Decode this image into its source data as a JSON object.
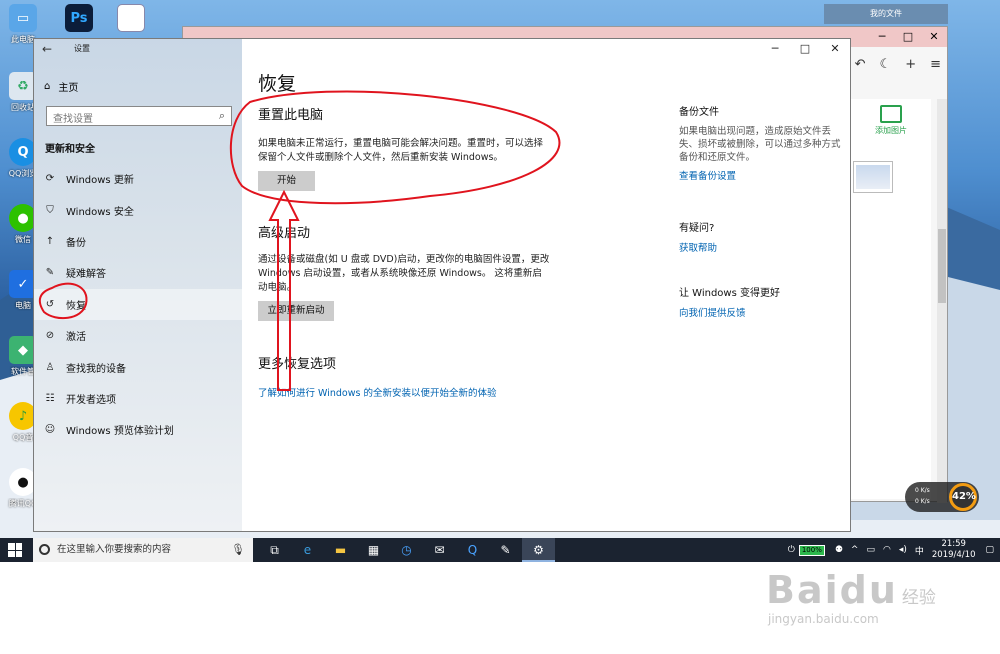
{
  "desktop": {
    "icons": [
      {
        "label": "此电脑",
        "icon": "computer-icon"
      },
      {
        "label": "回收站",
        "icon": "recycle-bin-icon"
      },
      {
        "label": "QQ浏览",
        "icon": "qq-browser-icon"
      },
      {
        "label": "微信",
        "icon": "wechat-icon"
      },
      {
        "label": "电脑",
        "icon": "pc-manager-icon"
      },
      {
        "label": "软件管",
        "icon": "software-manager-icon"
      },
      {
        "label": "QQ音",
        "icon": "qq-music-icon"
      },
      {
        "label": "腾讯QQ",
        "icon": "qq-icon"
      }
    ],
    "ps_label": "Ps",
    "bg_window_title": "我的文件",
    "bg_window_add_picture": "添加图片"
  },
  "settings": {
    "app_title": "设置",
    "home": "主页",
    "search_placeholder": "查找设置",
    "section": "更新和安全",
    "nav": [
      {
        "label": "Windows 更新",
        "icon": "refresh-icon"
      },
      {
        "label": "Windows 安全",
        "icon": "shield-icon"
      },
      {
        "label": "备份",
        "icon": "backup-arrow-icon"
      },
      {
        "label": "疑难解答",
        "icon": "wrench-icon"
      },
      {
        "label": "恢复",
        "icon": "history-icon"
      },
      {
        "label": "激活",
        "icon": "check-circle-icon"
      },
      {
        "label": "查找我的设备",
        "icon": "locate-icon"
      },
      {
        "label": "开发者选项",
        "icon": "developer-icon"
      },
      {
        "label": "Windows 预览体验计划",
        "icon": "insider-icon"
      }
    ],
    "active_index": 4,
    "page_title": "恢复",
    "reset": {
      "title": "重置此电脑",
      "desc": "如果电脑未正常运行，重置电脑可能会解决问题。重置时，可以选择保留个人文件或删除个人文件，然后重新安装 Windows。",
      "button": "开始"
    },
    "advanced": {
      "title": "高级启动",
      "desc": "通过设备或磁盘(如 U 盘或 DVD)启动，更改你的电脑固件设置，更改 Windows 启动设置，或者从系统映像还原 Windows。 这将重新启动电脑。",
      "button": "立即重新启动"
    },
    "more": {
      "title": "更多恢复选项",
      "link": "了解如何进行 Windows 的全新安装以便开始全新的体验"
    },
    "side": {
      "backup_title": "备份文件",
      "backup_desc": "如果电脑出现问题，造成原始文件丢失、损坏或被删除，可以通过多种方式备份和还原文件。",
      "backup_link": "查看备份设置",
      "help_title": "有疑问?",
      "help_link": "获取帮助",
      "improve_title": "让 Windows 变得更好",
      "improve_link": "向我们提供反馈"
    }
  },
  "taskbar": {
    "search_placeholder": "在这里输入你要搜索的内容",
    "battery": "100%",
    "ime": "中",
    "time": "21:59",
    "date": "2019/4/10",
    "widget_percent": "42%",
    "widget_rate1": "0 K/s",
    "widget_rate2": "0 K/s"
  },
  "watermark": {
    "brand": "Bai",
    "brand2": "du",
    "brand_cn": "经验",
    "url": "jingyan.baidu.com"
  },
  "colors": {
    "link": "#0063b1",
    "annotation": "#e0141e",
    "taskbar": "#1b2330"
  }
}
